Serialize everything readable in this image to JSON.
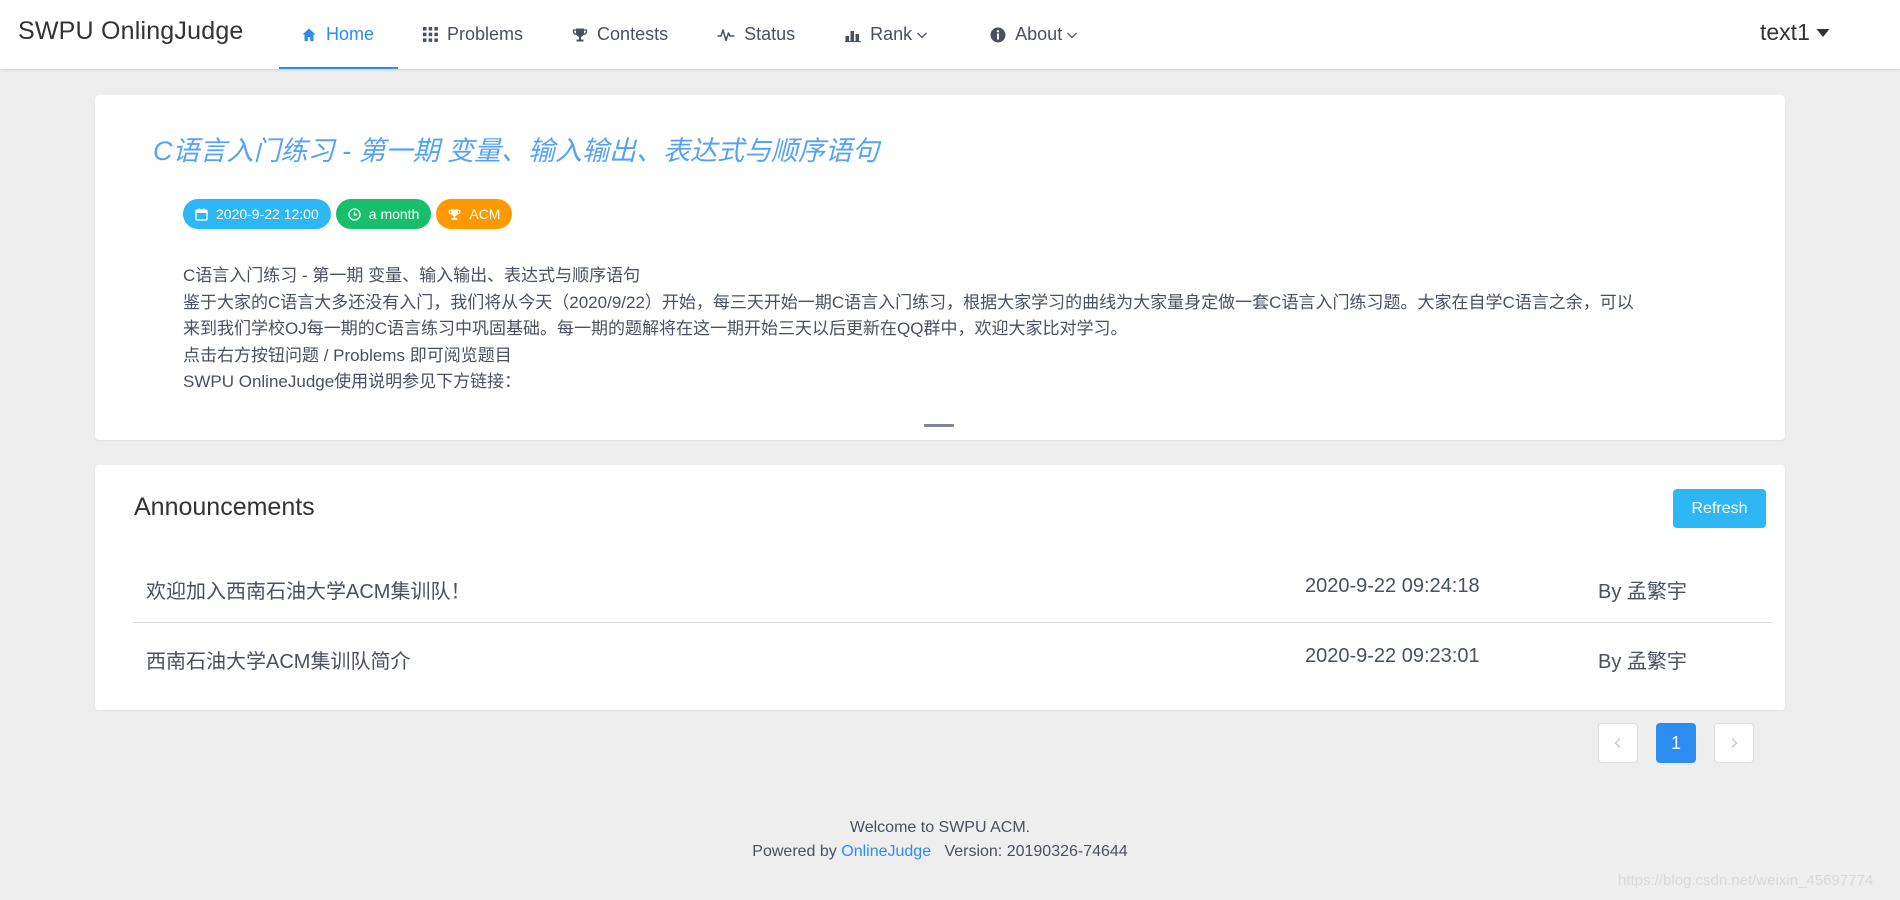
{
  "header": {
    "brand": "SWPU OnlingJudge",
    "nav": [
      {
        "label": "Home",
        "icon": "home-icon",
        "active": true
      },
      {
        "label": "Problems",
        "icon": "grid-icon"
      },
      {
        "label": "Contests",
        "icon": "trophy-icon"
      },
      {
        "label": "Status",
        "icon": "pulse-icon"
      },
      {
        "label": "Rank",
        "icon": "bar-chart-icon",
        "dropdown": true
      },
      {
        "label": "About",
        "icon": "info-icon",
        "dropdown": true
      }
    ],
    "username": "text1"
  },
  "contest": {
    "title": "C语言入门练习 - 第一期 变量、输入输出、表达式与顺序语句",
    "start_time": "2020-9-22 12:00",
    "duration": "a month",
    "rule_type": "ACM",
    "description_lines": [
      "C语言入门练习 - 第一期  变量、输入输出、表达式与顺序语句",
      "鉴于大家的C语言大多还没有入门，我们将从今天（2020/9/22）开始，每三天开始一期C语言入门练习，根据大家学习的曲线为大家量身定做一套C语言入门练习题。大家在自学C语言之余，可以",
      "来到我们学校OJ每一期的C语言练习中巩固基础。每一期的题解将在这一期开始三天以后更新在QQ群中，欢迎大家比对学习。",
      "点击右方按钮问题 / Problems 即可阅览题目",
      "SWPU OnlineJudge使用说明参见下方链接："
    ]
  },
  "announcements": {
    "title": "Announcements",
    "refresh_label": "Refresh",
    "items": [
      {
        "title": "欢迎加入西南石油大学ACM集训队！",
        "date": "2020-9-22 09:24:18",
        "author": "By 孟繁宇"
      },
      {
        "title": "西南石油大学ACM集训队简介",
        "date": "2020-9-22 09:23:01",
        "author": "By 孟繁宇"
      }
    ]
  },
  "pagination": {
    "current": "1"
  },
  "footer": {
    "welcome": "Welcome to SWPU ACM.",
    "powered_by": "Powered by",
    "link": "OnlineJudge",
    "version": "Version: 20190326-74644"
  },
  "watermark": "https://blog.csdn.net/weixin_45697774",
  "colors": {
    "primary": "#2d8cf0",
    "info": "#2db7f5",
    "success": "#19be6b",
    "warning": "#ff9900",
    "title_link": "#57a3f3"
  }
}
